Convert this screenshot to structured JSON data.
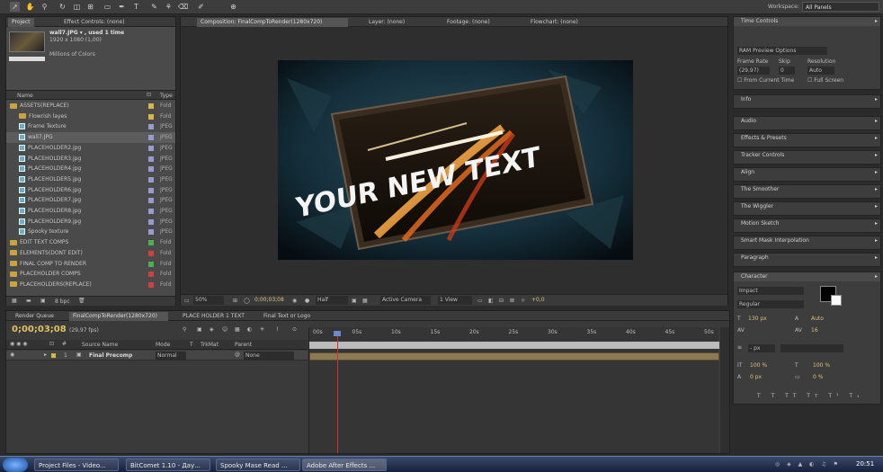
{
  "toolbar": {
    "workspace_label": "Workspace:",
    "workspace_value": "All Panels"
  },
  "project": {
    "tab_project": "Project",
    "tab_effect_controls": "Effect Controls: (none)",
    "thumb_name": "wall7.JPG ▾ , used 1 time",
    "thumb_size": "1920 x 1080 (1,00)",
    "thumb_colors": "Millions of Colors",
    "col_name": "Name",
    "col_type": "Type",
    "bpc": "8 bpc",
    "rows": [
      {
        "name": "ASSETS(REPLACE)",
        "type": "Fold",
        "kind": "folder",
        "indent": 0,
        "label": "#d4b84a"
      },
      {
        "name": "Flowrish layes",
        "type": "Fold",
        "kind": "folder",
        "indent": 1,
        "label": "#d4b84a"
      },
      {
        "name": "Frame Texture",
        "type": "JPEG",
        "kind": "file",
        "indent": 1,
        "label": "#9a9ad0"
      },
      {
        "name": "wall7.JPG",
        "type": "JPEG",
        "kind": "file",
        "indent": 1,
        "label": "#9a9ad0"
      },
      {
        "name": "PLACEHOLDER2.jpg",
        "type": "JPEG",
        "kind": "file",
        "indent": 1,
        "label": "#9a9ad0"
      },
      {
        "name": "PLACEHOLDER3.jpg",
        "type": "JPEG",
        "kind": "file",
        "indent": 1,
        "label": "#9a9ad0"
      },
      {
        "name": "PLACEHOLDER4.jpg",
        "type": "JPEG",
        "kind": "file",
        "indent": 1,
        "label": "#9a9ad0"
      },
      {
        "name": "PLACEHOLDER5.jpg",
        "type": "JPEG",
        "kind": "file",
        "indent": 1,
        "label": "#9a9ad0"
      },
      {
        "name": "PLACEHOLDER6.jpg",
        "type": "JPEG",
        "kind": "file",
        "indent": 1,
        "label": "#9a9ad0"
      },
      {
        "name": "PLACEHOLDER7.jpg",
        "type": "JPEG",
        "kind": "file",
        "indent": 1,
        "label": "#9a9ad0"
      },
      {
        "name": "PLACEHOLDER8.jpg",
        "type": "JPEG",
        "kind": "file",
        "indent": 1,
        "label": "#9a9ad0"
      },
      {
        "name": "PLACEHOLDER9.jpg",
        "type": "JPEG",
        "kind": "file",
        "indent": 1,
        "label": "#9a9ad0"
      },
      {
        "name": "Spooky texture",
        "type": "JPEG",
        "kind": "file",
        "indent": 1,
        "label": "#9a9ad0"
      },
      {
        "name": "EDIT TEXT COMPS",
        "type": "Fold",
        "kind": "folder",
        "indent": 0,
        "label": "#4cb04c"
      },
      {
        "name": "ELEMENTS(DONT EDIT)",
        "type": "Fold",
        "kind": "folder",
        "indent": 0,
        "label": "#d04040"
      },
      {
        "name": "FINAL COMP TO RENDER",
        "type": "Fold",
        "kind": "folder",
        "indent": 0,
        "label": "#4cb04c"
      },
      {
        "name": "PLACEHOLDER COMPS",
        "type": "Fold",
        "kind": "folder",
        "indent": 0,
        "label": "#d04040"
      },
      {
        "name": "PLACEHOLDERS(REPLACE)",
        "type": "Fold",
        "kind": "folder",
        "indent": 0,
        "label": "#d04040"
      }
    ]
  },
  "comp": {
    "tab_comp": "Composition: FinalCompToRender(1280x720)",
    "tab_layer": "Layer: (none)",
    "tab_footage": "Footage: (none)",
    "tab_flowchart": "Flowchart: (none)",
    "overlay_text": "YOUR NEW TEXT",
    "zoom": "50%",
    "timecode": "0;00;03;08",
    "resolution": "Half",
    "camera": "Active Camera",
    "views": "1 View",
    "exposure": "+0,0"
  },
  "right": {
    "time_controls": "Time Controls",
    "ram_preview": "RAM Preview Options",
    "frame_rate_label": "Frame Rate",
    "skip_label": "Skip",
    "resolution_label": "Resolution",
    "frame_rate_value": "(29,97)",
    "skip_value": "0",
    "resolution_value": "Auto",
    "from_current": "From Current Time",
    "full_screen": "Full Screen",
    "panels": [
      "Info",
      "Audio",
      "Effects & Presets",
      "Tracker Controls",
      "Align",
      "The Smoother",
      "The Wiggler",
      "Motion Sketch",
      "Smart Mask Interpolation",
      "Paragraph"
    ],
    "character": "Character",
    "font": "Impact",
    "style": "Regular",
    "font_size": "130 px",
    "leading": "Auto",
    "tracking": "16",
    "stroke": "- px",
    "vscale": "100 %",
    "hscale": "100 %",
    "baseline": "0 px",
    "tsume": "0 %"
  },
  "timeline": {
    "tab_render": "Render Queue",
    "tab_final": "FinalCompToRender(1280x720)",
    "tab_placeholder": "PLACE HOLDER 1 TEXT",
    "tab_final_text": "Final Text or Logo",
    "timecode": "0;00;03;08",
    "fps": "(29,97 fps)",
    "col_source": "Source Name",
    "col_mode": "Mode",
    "col_t": "T",
    "col_trkmat": "TrkMat",
    "col_parent": "Parent",
    "layer_num": "1",
    "layer_name": "Final Precomp",
    "layer_mode": "Normal",
    "layer_parent": "None",
    "ruler": [
      "00s",
      "05s",
      "10s",
      "15s",
      "20s",
      "25s",
      "30s",
      "35s",
      "40s",
      "45s",
      "50s"
    ]
  },
  "taskbar": {
    "items": [
      "Project Files - Video...",
      "BitComet 1.10 - Дау...",
      "Spooky Mase Read ...",
      "Adobe After Effects ..."
    ],
    "clock": "20:51"
  }
}
